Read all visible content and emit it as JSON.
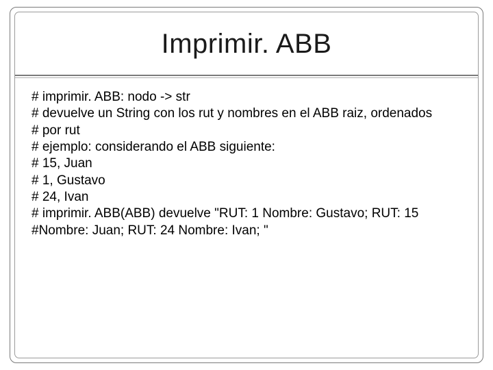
{
  "title": "Imprimir. ABB",
  "lines": {
    "l1": "# imprimir. ABB: nodo -> str",
    "l2": "# devuelve un String con los rut y nombres en el ABB raiz, ordenados",
    "l3": "# por rut",
    "l4": "# ejemplo: considerando el ABB siguiente:",
    "l5": "# 15, Juan",
    "l6": "# 1, Gustavo",
    "l7": "# 24, Ivan",
    "l8": "# imprimir. ABB(ABB) devuelve \"RUT: 1 Nombre: Gustavo; RUT: 15",
    "l9": "#Nombre: Juan; RUT: 24 Nombre: Ivan; \""
  }
}
